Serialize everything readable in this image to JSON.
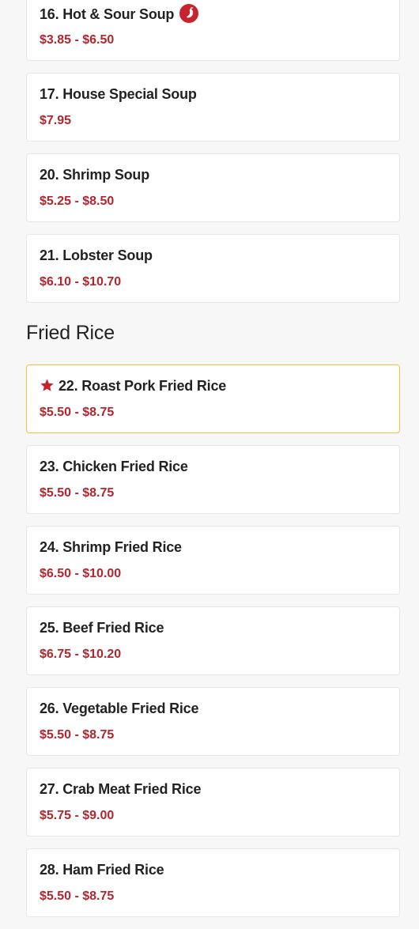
{
  "colors": {
    "price": "#b3262e",
    "accent_red": "#c8232c",
    "featured_border": "#f0c040"
  },
  "soups": [
    {
      "name": "16. Hot & Sour Soup",
      "price": "$3.85 - $6.50",
      "icon": "chili-pepper-icon"
    },
    {
      "name": "17. House Special Soup",
      "price": "$7.95"
    },
    {
      "name": "20. Shrimp Soup",
      "price": "$5.25 - $8.50"
    },
    {
      "name": "21. Lobster Soup",
      "price": "$6.10 - $10.70"
    }
  ],
  "fried_rice": {
    "heading": "Fried Rice",
    "items": [
      {
        "name": "22. Roast Pork Fried Rice",
        "price": "$5.50 - $8.75",
        "icon": "star-icon"
      },
      {
        "name": "23. Chicken Fried Rice",
        "price": "$5.50 - $8.75"
      },
      {
        "name": "24. Shrimp Fried Rice",
        "price": "$6.50 - $10.00"
      },
      {
        "name": "25. Beef Fried Rice",
        "price": "$6.75 - $10.20"
      },
      {
        "name": "26. Vegetable Fried Rice",
        "price": "$5.50 - $8.75"
      },
      {
        "name": "27. Crab Meat Fried Rice",
        "price": "$5.75 - $9.00"
      },
      {
        "name": "28. Ham Fried Rice",
        "price": "$5.50 - $8.75"
      }
    ]
  }
}
